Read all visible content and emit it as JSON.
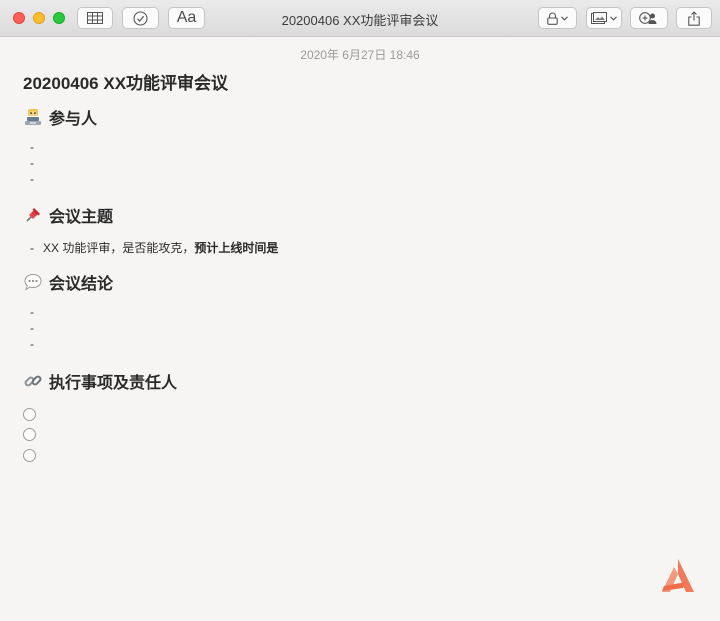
{
  "window": {
    "title": "20200406 XX功能评审会议"
  },
  "toolbar": {
    "format_label": "Aa"
  },
  "note": {
    "timestamp": "2020年 6月27日 18:46",
    "title": "20200406 XX功能评审会议",
    "sections": [
      {
        "heading": "参与人",
        "emoji_icon": "technologist-icon",
        "items": [
          "-",
          "-",
          "-"
        ]
      },
      {
        "heading": "会议主题",
        "emoji_icon": "pushpin-icon",
        "items": [
          {
            "bullet": "-",
            "text_prefix": "XX 功能评审，是否能攻克，",
            "text_bold": "预计上线时间是"
          }
        ]
      },
      {
        "heading": "会议结论",
        "emoji_icon": "speech-balloon-icon",
        "items": [
          "-",
          "-",
          "-"
        ]
      },
      {
        "heading": "执行事项及责任人",
        "emoji_icon": "link-icon",
        "checklist": [
          {
            "checked": false,
            "text": ""
          },
          {
            "checked": false,
            "text": ""
          },
          {
            "checked": false,
            "text": ""
          }
        ]
      }
    ]
  },
  "colors": {
    "accent_watermark": "#f07a5a",
    "background": "#f6f5f3"
  }
}
